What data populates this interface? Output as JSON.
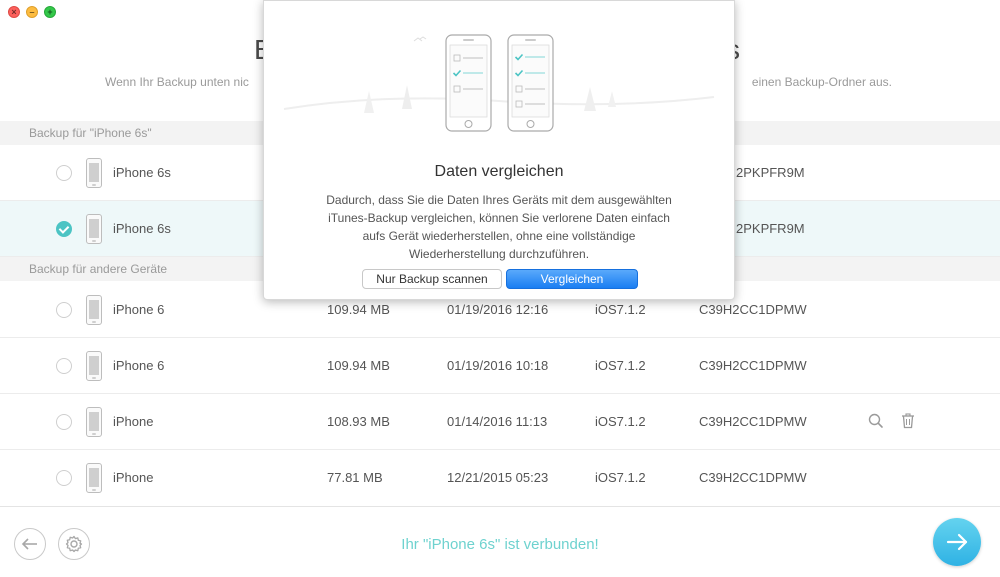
{
  "window": {
    "close_glyph": "×",
    "minimize_glyph": "–",
    "zoom_glyph": "+"
  },
  "header": {
    "title_left": "B",
    "title_right": "s",
    "subtitle_left": "Wenn Ihr Backup unten nic",
    "subtitle_right": "einen Backup-Ordner aus."
  },
  "sections": {
    "current": "Backup für \"iPhone 6s\"",
    "other": "Backup für andere Geräte"
  },
  "current_rows": [
    {
      "name": "iPhone 6s",
      "serial_partial": "2PKPFR9M",
      "selected": false
    },
    {
      "name": "iPhone 6s",
      "serial_partial": "2PKPFR9M",
      "selected": true
    }
  ],
  "other_rows": [
    {
      "name": "iPhone 6",
      "size": "109.94 MB",
      "date": "01/19/2016 12:16",
      "ios": "iOS7.1.2",
      "serial": "C39H2CC1DPMW"
    },
    {
      "name": "iPhone 6",
      "size": "109.94 MB",
      "date": "01/19/2016 10:18",
      "ios": "iOS7.1.2",
      "serial": "C39H2CC1DPMW"
    },
    {
      "name": "iPhone",
      "size": "108.93 MB",
      "date": "01/14/2016 11:13",
      "ios": "iOS7.1.2",
      "serial": "C39H2CC1DPMW"
    },
    {
      "name": "iPhone",
      "size": "77.81 MB",
      "date": "12/21/2015 05:23",
      "ios": "iOS7.1.2",
      "serial": "C39H2CC1DPMW"
    }
  ],
  "modal": {
    "title": "Daten vergleichen",
    "text_lines": [
      "Dadurch, dass Sie die Daten Ihres Geräts mit dem ausgewählten",
      "iTunes-Backup vergleichen, können Sie verlorene Daten einfach",
      "aufs Gerät wiederherstellen, ohne eine vollständige",
      "Wiederherstellung durchzuführen."
    ],
    "secondary_button": "Nur Backup scannen",
    "primary_button": "Vergleichen"
  },
  "footer": {
    "status": "Ihr \"iPhone 6s\" ist verbunden!"
  },
  "colors": {
    "accent_teal": "#4cc4c4",
    "status_text": "#6ed2cf",
    "primary_blue": "#1a7ef2",
    "next_button": "#3ab8e6"
  },
  "icons": [
    "back-arrow-icon",
    "gear-icon",
    "search-icon",
    "trash-icon",
    "arrow-right-icon",
    "iphone-icon",
    "checkmark-icon"
  ]
}
